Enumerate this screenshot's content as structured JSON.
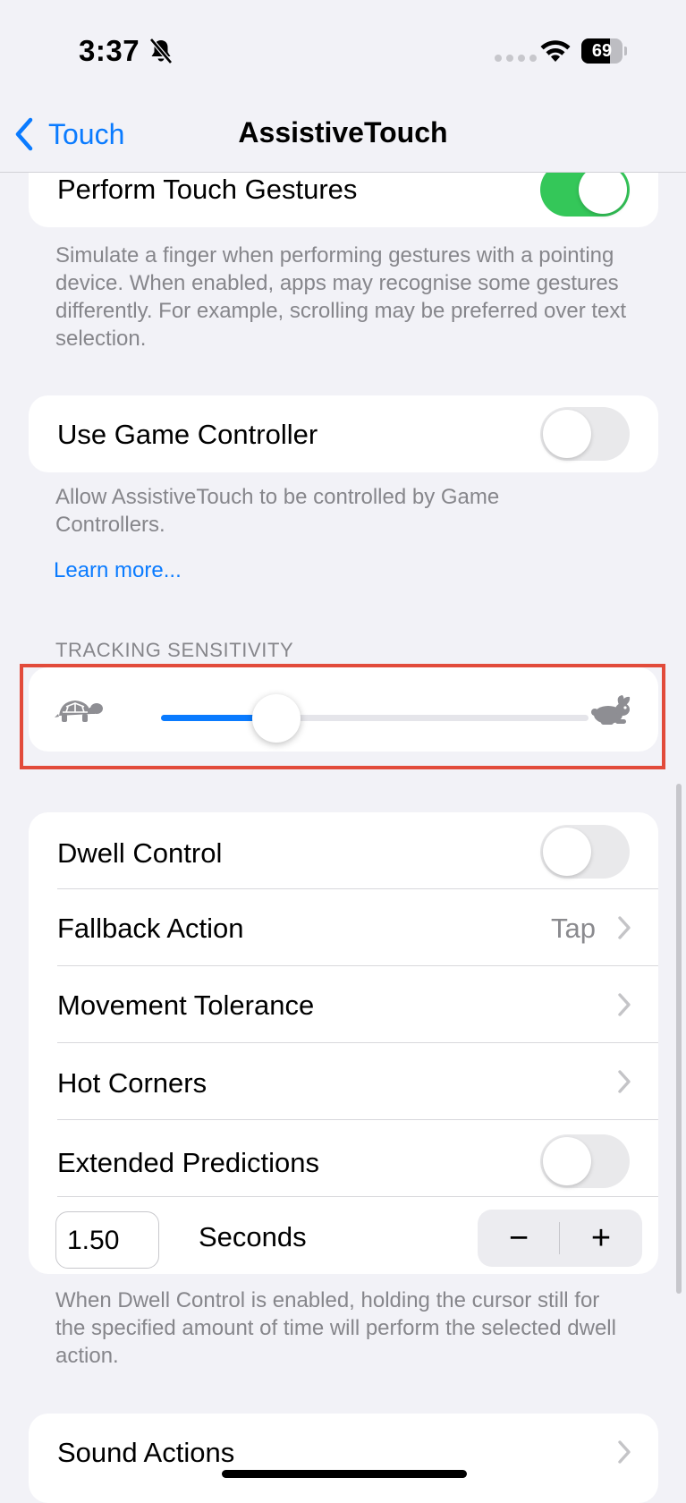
{
  "status_bar": {
    "time": "3:37",
    "battery": "69",
    "battery_level": 0.69,
    "icons": [
      "bell-slash-icon",
      "cellular-dots-icon",
      "wifi-icon",
      "battery-icon"
    ]
  },
  "nav": {
    "back_label": "Touch",
    "title": "AssistiveTouch"
  },
  "perform_gestures": {
    "label": "Perform Touch Gestures",
    "enabled": true,
    "footer": "Simulate a finger when performing gestures with a pointing device. When enabled, apps may recognise some gestures differently. For example, scrolling may be preferred over text selection."
  },
  "game_controller": {
    "label": "Use Game Controller",
    "enabled": false,
    "footer": "Allow AssistiveTouch to be controlled by Game Controllers.",
    "learn_more": "Learn more..."
  },
  "tracking": {
    "header": "TRACKING SENSITIVITY",
    "value": 0.27,
    "min_icon": "tortoise-icon",
    "max_icon": "hare-icon"
  },
  "dwell": {
    "dwell_control": {
      "label": "Dwell Control",
      "enabled": false
    },
    "fallback_action": {
      "label": "Fallback Action",
      "value": "Tap"
    },
    "movement_tolerance": {
      "label": "Movement Tolerance"
    },
    "hot_corners": {
      "label": "Hot Corners"
    },
    "extended_predictions": {
      "label": "Extended Predictions",
      "enabled": false
    },
    "seconds_value": "1.50",
    "seconds_label": "Seconds",
    "minus": "−",
    "plus": "+",
    "footer": "When Dwell Control is enabled, holding the cursor still for the specified amount of time will perform the selected dwell action."
  },
  "sound_actions": {
    "label": "Sound Actions"
  },
  "colors": {
    "accent": "#0a7bff",
    "toggle_on": "#34c759",
    "highlight": "#e24b3b"
  }
}
